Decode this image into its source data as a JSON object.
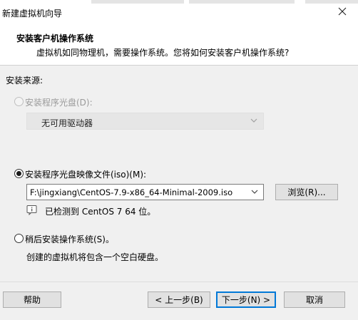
{
  "window": {
    "title": "新建虚拟机向导"
  },
  "header": {
    "title": "安装客户机操作系统",
    "subtitle": "虚拟机如同物理机，需要操作系统。您将如何安装客户机操作系统?"
  },
  "source": {
    "label": "安装来源:",
    "options": [
      {
        "label": "安装程序光盘(D):",
        "checked": false,
        "disabled": true
      },
      {
        "label": "安装程序光盘映像文件(iso)(M):",
        "checked": true,
        "disabled": false
      },
      {
        "label": "稍后安装操作系统(S)。",
        "checked": false,
        "disabled": false
      }
    ],
    "drive_select": "无可用驱动器",
    "iso_path": "F:\\jingxiang\\CentOS-7.9-x86_64-Minimal-2009.iso",
    "browse_label": "浏览(R)...",
    "detected_text": "已检测到 CentOS 7 64 位。",
    "later_note": "创建的虚拟机将包含一个空白硬盘。"
  },
  "footer": {
    "help": "帮助",
    "back": "< 上一步(B)",
    "next": "下一步(N) >",
    "cancel": "取消"
  }
}
